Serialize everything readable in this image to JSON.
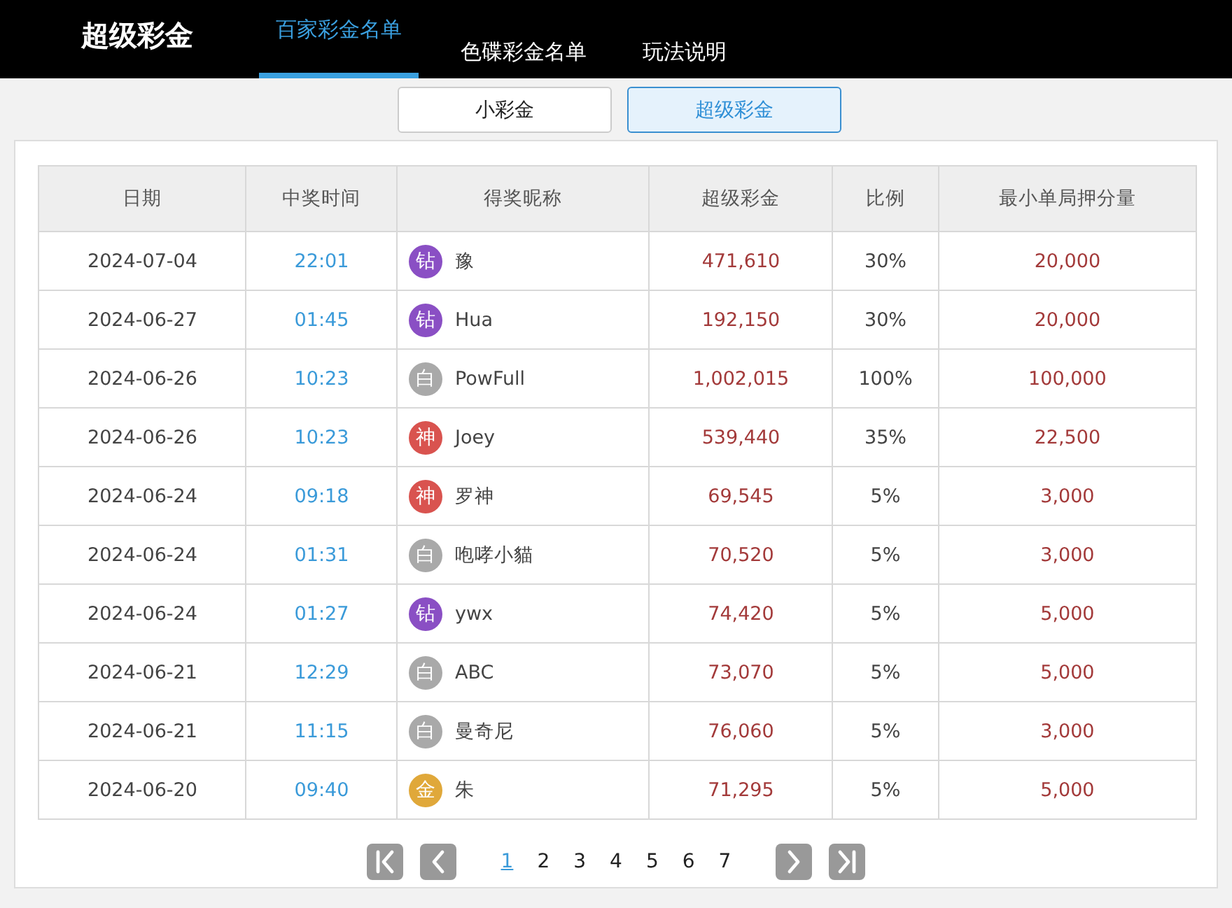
{
  "header": {
    "title": "超级彩金",
    "tabs": [
      {
        "label": "百家彩金名单",
        "selected": true
      },
      {
        "label": "色碟彩金名单",
        "selected": false
      },
      {
        "label": "玩法说明",
        "selected": false
      }
    ]
  },
  "subtabs": [
    {
      "label": "小彩金",
      "selected": false
    },
    {
      "label": "超级彩金",
      "selected": true
    }
  ],
  "table": {
    "columns": [
      "日期",
      "中奖时间",
      "得奖昵称",
      "超级彩金",
      "比例",
      "最小单局押分量"
    ],
    "rows": [
      {
        "date": "2024-07-04",
        "time": "22:01",
        "badge": "钻",
        "color": "#8a4fc4",
        "name": "豫",
        "jackpot": "471,610",
        "ratio": "30%",
        "min_bet": "20,000"
      },
      {
        "date": "2024-06-27",
        "time": "01:45",
        "badge": "钻",
        "color": "#8a4fc4",
        "name": "Hua",
        "jackpot": "192,150",
        "ratio": "30%",
        "min_bet": "20,000"
      },
      {
        "date": "2024-06-26",
        "time": "10:23",
        "badge": "白",
        "color": "#a9a9a9",
        "name": "PowFull",
        "jackpot": "1,002,015",
        "ratio": "100%",
        "min_bet": "100,000"
      },
      {
        "date": "2024-06-26",
        "time": "10:23",
        "badge": "神",
        "color": "#d9534f",
        "name": "Joey",
        "jackpot": "539,440",
        "ratio": "35%",
        "min_bet": "22,500"
      },
      {
        "date": "2024-06-24",
        "time": "09:18",
        "badge": "神",
        "color": "#d9534f",
        "name": "罗神",
        "jackpot": "69,545",
        "ratio": "5%",
        "min_bet": "3,000"
      },
      {
        "date": "2024-06-24",
        "time": "01:31",
        "badge": "白",
        "color": "#a9a9a9",
        "name": "咆哮小貓",
        "jackpot": "70,520",
        "ratio": "5%",
        "min_bet": "3,000"
      },
      {
        "date": "2024-06-24",
        "time": "01:27",
        "badge": "钻",
        "color": "#8a4fc4",
        "name": "ywx",
        "jackpot": "74,420",
        "ratio": "5%",
        "min_bet": "5,000"
      },
      {
        "date": "2024-06-21",
        "time": "12:29",
        "badge": "白",
        "color": "#a9a9a9",
        "name": "ABC",
        "jackpot": "73,070",
        "ratio": "5%",
        "min_bet": "5,000"
      },
      {
        "date": "2024-06-21",
        "time": "11:15",
        "badge": "白",
        "color": "#a9a9a9",
        "name": "曼奇尼",
        "jackpot": "76,060",
        "ratio": "5%",
        "min_bet": "3,000"
      },
      {
        "date": "2024-06-20",
        "time": "09:40",
        "badge": "金",
        "color": "#e0a83a",
        "name": "朱",
        "jackpot": "71,295",
        "ratio": "5%",
        "min_bet": "5,000"
      }
    ]
  },
  "pagination": {
    "pages": [
      {
        "label": "1",
        "selected": true
      },
      {
        "label": "2",
        "selected": false
      },
      {
        "label": "3",
        "selected": false
      },
      {
        "label": "4",
        "selected": false
      },
      {
        "label": "5",
        "selected": false
      },
      {
        "label": "6",
        "selected": false
      },
      {
        "label": "7",
        "selected": false
      }
    ]
  }
}
